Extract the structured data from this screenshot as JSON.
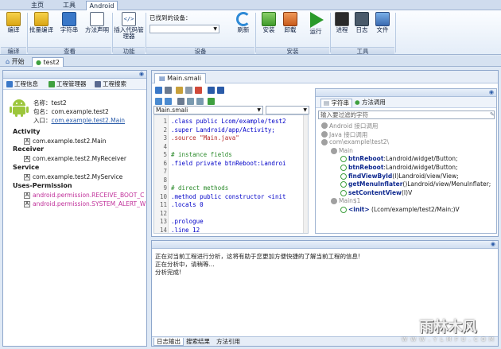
{
  "ribbon_tabs": [
    "主页",
    "工具",
    "Android"
  ],
  "ribbon": {
    "groups": [
      {
        "label": "编译",
        "buttons": [
          "编译"
        ]
      },
      {
        "label": "查看",
        "buttons": [
          "批量编译",
          "字符串",
          "方法声明"
        ]
      },
      {
        "label": "功能",
        "buttons": [
          "插入代码管理器"
        ]
      },
      {
        "label": "设备",
        "device_label": "已找到的设备：",
        "device_value": "",
        "buttons": [
          "刷新"
        ]
      },
      {
        "label": "安装",
        "buttons": [
          "安装",
          "卸载",
          "运行"
        ]
      },
      {
        "label": "工具",
        "buttons": [
          "进程",
          "日志",
          "文件"
        ]
      }
    ]
  },
  "doc_tabs": [
    "开始",
    "test2"
  ],
  "left_panel": {
    "tabs": [
      "工程信息",
      "工程管理器",
      "工程搜索"
    ],
    "info": [
      {
        "label": "名称：",
        "value": "test2"
      },
      {
        "label": "包名：",
        "value": "com.example.test2"
      },
      {
        "label": "入口：",
        "value": "com.example.test2.Main"
      }
    ],
    "sections": [
      {
        "title": "Activity",
        "items": [
          "com.example.test2.Main"
        ]
      },
      {
        "title": "Receiver",
        "items": [
          "com.example.test2.MyReceiver"
        ]
      },
      {
        "title": "Service",
        "items": [
          "com.example.test2.MyService"
        ]
      },
      {
        "title": "Uses-Permission",
        "items": [
          "android.permission.RECEIVE_BOOT_C",
          "android.permission.SYSTEM_ALERT_W"
        ]
      }
    ]
  },
  "editor": {
    "file_tab": "Main.smali",
    "class_combo": "Main.smali",
    "method_combo": "",
    "lines": [
      {
        "n": "1",
        "text": ".class public Lcom/example/test2"
      },
      {
        "n": "2",
        "text": ".super Landroid/app/Activity;"
      },
      {
        "n": "3",
        "text": ".source \"Main.java\""
      },
      {
        "n": "4",
        "text": ""
      },
      {
        "n": "5",
        "text": "# instance fields"
      },
      {
        "n": "6",
        "text": ".field private btnReboot:Landroi"
      },
      {
        "n": "7",
        "text": ""
      },
      {
        "n": "8",
        "text": ""
      },
      {
        "n": "9",
        "text": "# direct methods"
      },
      {
        "n": "10",
        "text": ".method public constructor <init"
      },
      {
        "n": "11",
        "text": "    .locals 0"
      },
      {
        "n": "12",
        "text": ""
      },
      {
        "n": "13",
        "text": "    .prologue"
      },
      {
        "n": "14",
        "text": "    .line 12"
      }
    ]
  },
  "lookup": {
    "tabs": [
      "字符串",
      "方法调用"
    ],
    "filter_placeholder": "输入要过滤的字符",
    "tree": [
      {
        "text": "Android 接口调用",
        "level": 0,
        "kind": "gray"
      },
      {
        "text": "Java 接口调用",
        "level": 0,
        "kind": "gray"
      },
      {
        "text": "com\\example\\test2\\",
        "level": 0,
        "kind": "gray"
      },
      {
        "text": "Main",
        "level": 1,
        "kind": "gray"
      },
      {
        "method": "btnReboot",
        "sig": ":Landroid/widget/Button;",
        "level": 2,
        "kind": "method"
      },
      {
        "method": "btnReboot",
        "sig": ":Landroid/widget/Button;",
        "level": 2,
        "kind": "method"
      },
      {
        "method": "findViewById",
        "sig": "(I)Landroid/view/View;",
        "level": 2,
        "kind": "method"
      },
      {
        "method": "getMenuInflater",
        "sig": "()Landroid/view/MenuInflater;",
        "level": 2,
        "kind": "method"
      },
      {
        "method": "setContentView",
        "sig": "(I)V",
        "level": 2,
        "kind": "method"
      },
      {
        "text": "Main$1",
        "level": 1,
        "kind": "gray"
      },
      {
        "method": "<init>",
        "sig": " (Lcom/example/test2/Main;)V",
        "level": 2,
        "kind": "method"
      }
    ]
  },
  "log": {
    "lines": [
      "正在对当前工程进行分析，这将有助于您更加方便快捷的了解当前工程的信息!",
      "正在分析中，请稍等...",
      "分析完成!"
    ],
    "tabs": [
      "日志输出",
      "搜索结果",
      "方法引用"
    ]
  },
  "watermark": {
    "title": "雨林木风",
    "url": "W W W . Y L M F U . C O M"
  },
  "colors": {
    "accent": "#2a5ba8",
    "permission": "#c0309a",
    "method": "#102a90",
    "comment": "#2a8a2a",
    "keyword": "#0000c8",
    "string": "#b5292a"
  }
}
